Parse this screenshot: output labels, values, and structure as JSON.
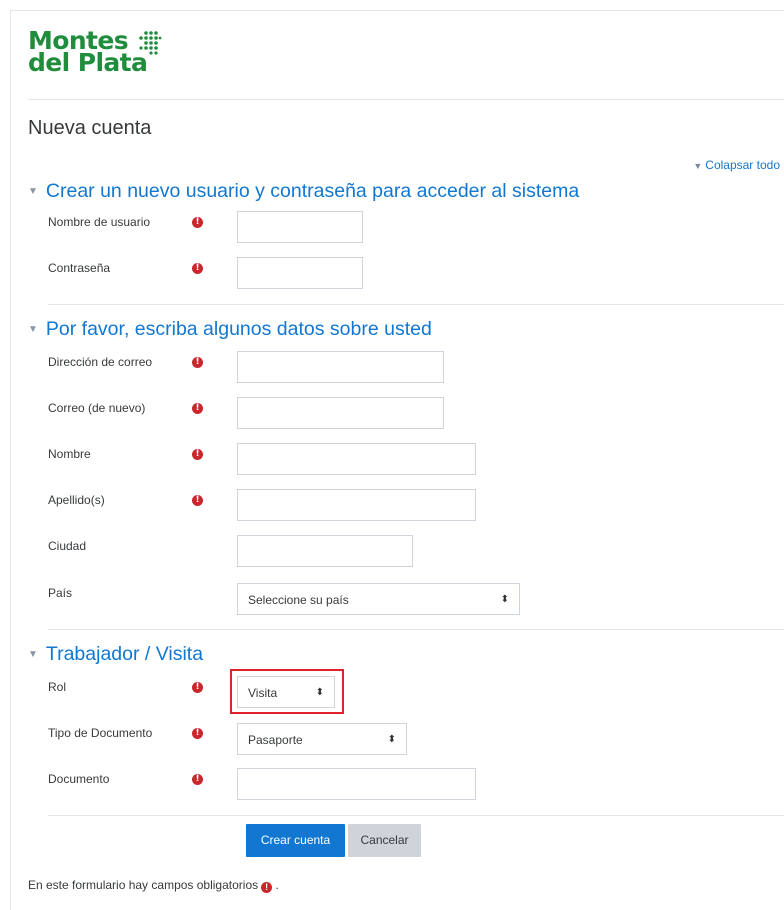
{
  "logo": {
    "line1": "Montes",
    "line2": "del Plata"
  },
  "page_title": "Nueva cuenta",
  "collapse_all": "Colapsar todo",
  "sections": [
    {
      "title": "Crear un nuevo usuario y contraseña para acceder al sistema"
    },
    {
      "title": "Por favor, escriba algunos datos sobre usted"
    },
    {
      "title": "Trabajador / Visita"
    }
  ],
  "fields": {
    "username": {
      "label": "Nombre de usuario",
      "value": ""
    },
    "password": {
      "label": "Contraseña",
      "value": ""
    },
    "email": {
      "label": "Dirección de correo",
      "value": ""
    },
    "email2": {
      "label": "Correo (de nuevo)",
      "value": ""
    },
    "firstname": {
      "label": "Nombre",
      "value": ""
    },
    "lastname": {
      "label": "Apellido(s)",
      "value": ""
    },
    "city": {
      "label": "Ciudad",
      "value": ""
    },
    "country": {
      "label": "País",
      "selected": "Seleccione su país"
    },
    "role": {
      "label": "Rol",
      "selected": "Visita"
    },
    "doc_type": {
      "label": "Tipo de Documento",
      "selected": "Pasaporte"
    },
    "document": {
      "label": "Documento",
      "value": ""
    }
  },
  "required_icon": "!",
  "buttons": {
    "create": "Crear cuenta",
    "cancel": "Cancelar"
  },
  "footer": {
    "note": "En este formulario hay campos obligatorios",
    "note_end": "."
  },
  "colors": {
    "brand_green": "#1f8d3c",
    "link_blue": "#1177d1",
    "required_red": "#c9272b",
    "highlight_red": "#e2222a"
  }
}
